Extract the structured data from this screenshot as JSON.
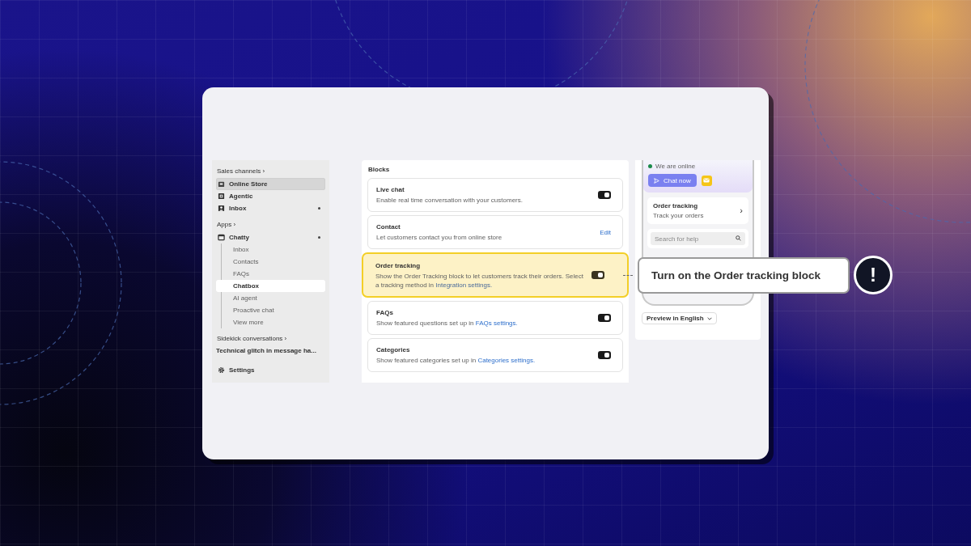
{
  "sidebar": {
    "items": [
      {
        "kind": "heading",
        "label": "Sales channels",
        "chevron": "›"
      },
      {
        "kind": "item",
        "label": "Online Store",
        "selected": true,
        "dot": false
      },
      {
        "kind": "item",
        "label": "Agentic",
        "selected": false,
        "dot": false
      },
      {
        "kind": "item",
        "label": "Inbox",
        "selected": false,
        "dot": true
      },
      {
        "kind": "heading",
        "label": "Apps",
        "chevron": "›"
      },
      {
        "kind": "item",
        "label": "Chatty",
        "selected": false,
        "dot": true
      },
      {
        "kind": "subitem",
        "label": "Inbox",
        "selected": false
      },
      {
        "kind": "subitem",
        "label": "Contacts",
        "selected": false
      },
      {
        "kind": "subitem",
        "label": "FAQs",
        "selected": false
      },
      {
        "kind": "subitem",
        "label": "Chatbox",
        "selected": true
      },
      {
        "kind": "subitem",
        "label": "AI agent",
        "selected": false
      },
      {
        "kind": "subitem",
        "label": "Proactive chat",
        "selected": false
      },
      {
        "kind": "subitem",
        "label": "View more",
        "selected": false
      },
      {
        "kind": "heading",
        "label": "Sidekick conversations",
        "chevron": "›"
      },
      {
        "kind": "conversation",
        "label": "Technical glitch in message ha..."
      },
      {
        "kind": "item",
        "label": "Settings",
        "selected": false,
        "dot": false
      }
    ]
  },
  "blocks": {
    "title": "Blocks",
    "items": [
      {
        "kind": "toggle",
        "title": "Live chat",
        "description": "Enable real time conversation with your customers.",
        "on": true,
        "highlighted": false
      },
      {
        "kind": "link",
        "title": "Contact",
        "description": "Let customers contact you from online store",
        "action": "Edit",
        "highlighted": false
      },
      {
        "kind": "toggle",
        "title": "Order tracking",
        "description": "Show the Order Tracking block to let customers track their orders. Select a tracking method in",
        "link": "Integration settings.",
        "on": true,
        "highlighted": true
      },
      {
        "kind": "toggle",
        "title": "FAQs",
        "description": "Show featured questions set up in",
        "link": "FAQs settings.",
        "on": true,
        "highlighted": false
      },
      {
        "kind": "toggle",
        "title": "Categories",
        "description": "Show featured categories set up in",
        "link": "Categories settings.",
        "on": true,
        "highlighted": false
      }
    ]
  },
  "preview": {
    "status": "We are online",
    "chat_button": "Chat now",
    "order_card": {
      "title": "Order tracking",
      "subtitle": "Track your orders",
      "chevron": "›"
    },
    "search": {
      "placeholder": "Search for help"
    },
    "language_button": "Preview in English"
  },
  "callout": {
    "text": "Turn on the Order tracking block",
    "badge": "!"
  }
}
